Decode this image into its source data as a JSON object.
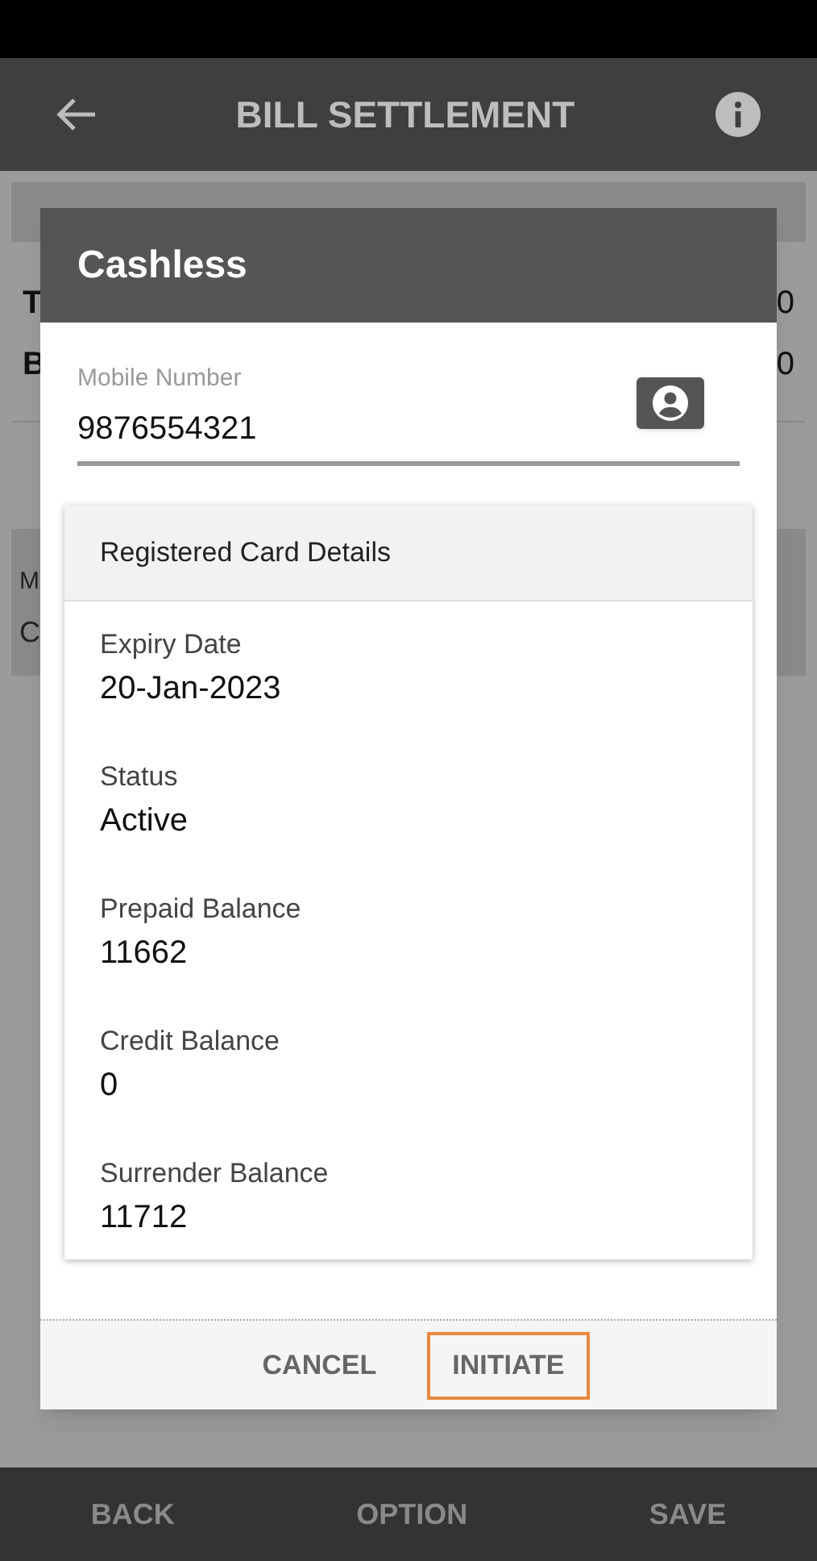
{
  "app_bar": {
    "title": "BILL SETTLEMENT"
  },
  "background": {
    "rows": [
      {
        "label": "T",
        "value": "0"
      },
      {
        "label": "B",
        "value": "0"
      }
    ],
    "section_label": "M",
    "section_value": "C"
  },
  "dialog": {
    "title": "Cashless",
    "mobile_field": {
      "label": "Mobile Number",
      "value": "9876554321"
    },
    "card": {
      "title": "Registered Card Details",
      "fields": [
        {
          "label": "Expiry Date",
          "value": "20-Jan-2023"
        },
        {
          "label": "Status",
          "value": "Active"
        },
        {
          "label": "Prepaid Balance",
          "value": "11662"
        },
        {
          "label": "Credit Balance",
          "value": "0"
        },
        {
          "label": "Surrender Balance",
          "value": "11712"
        }
      ]
    },
    "buttons": [
      {
        "label": "CANCEL",
        "focused": false
      },
      {
        "label": "INITIATE",
        "focused": true
      }
    ]
  },
  "bottom_nav": [
    "BACK",
    "OPTION",
    "SAVE"
  ]
}
